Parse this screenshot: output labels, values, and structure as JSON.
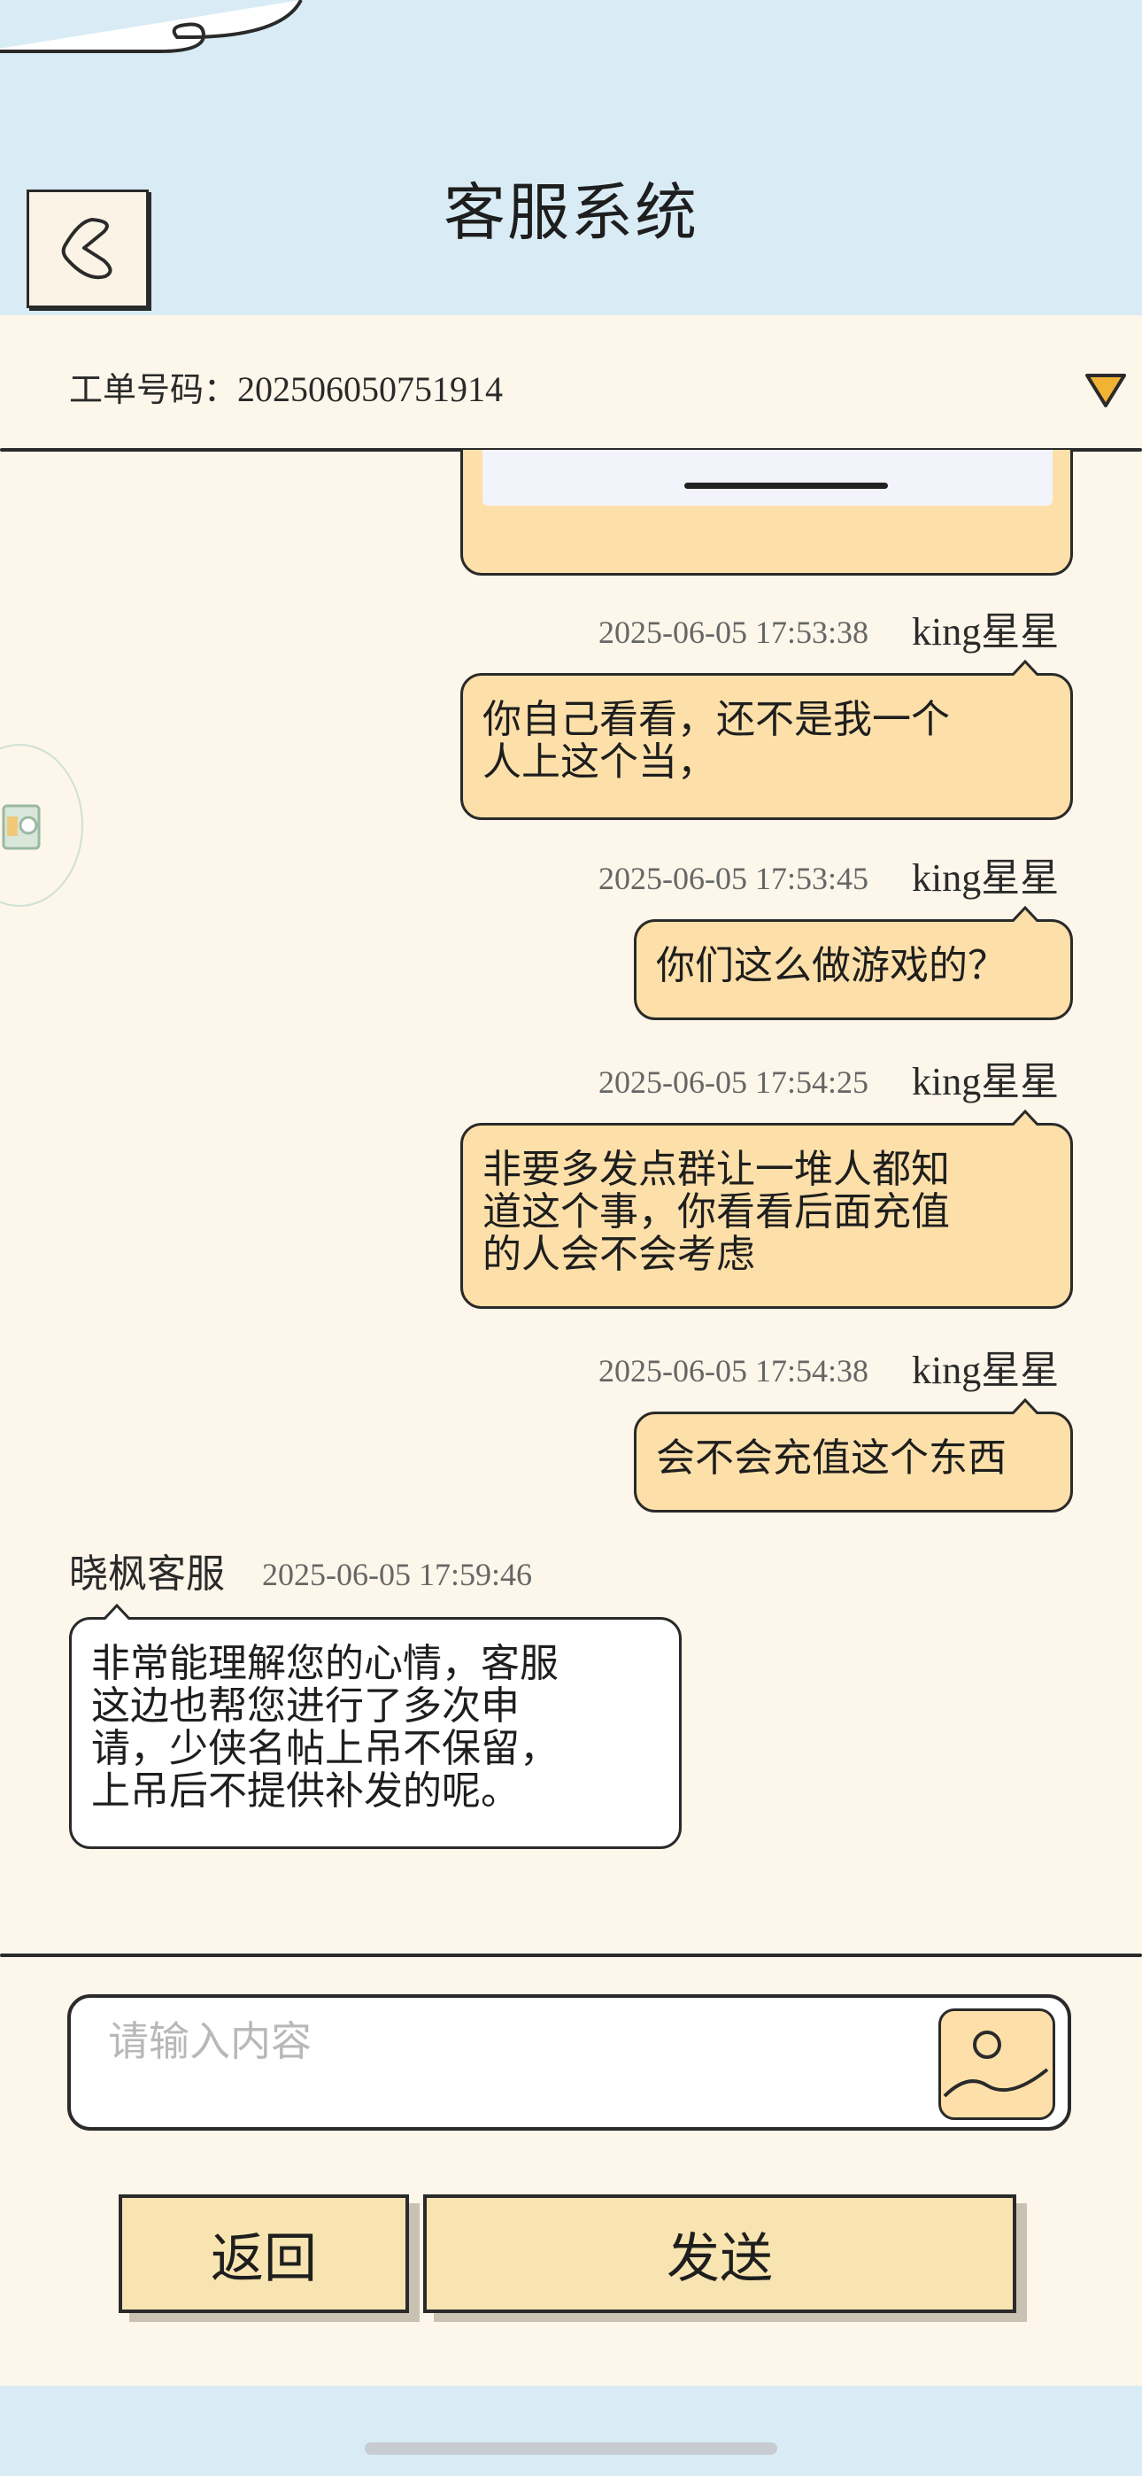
{
  "header": {
    "title": "客服系统"
  },
  "ticket": {
    "label": "工单号码：",
    "number": "202506050751914"
  },
  "messages": [
    {
      "time": "2025-06-05 17:53:38",
      "sender": "king星星",
      "text": "你自己看看，还不是我一个人上这个当，",
      "lines": [
        "你自己看看，还不是我一个",
        "人上这个当，"
      ]
    },
    {
      "time": "2025-06-05 17:53:45",
      "sender": "king星星",
      "text": "你们这么做游戏的？",
      "lines": [
        "你们这么做游戏的？"
      ]
    },
    {
      "time": "2025-06-05 17:54:25",
      "sender": "king星星",
      "text": "非要多发点群让一堆人都知道这个事，你看看后面充值的人会不会考虑",
      "lines": [
        "非要多发点群让一堆人都知",
        "道这个事，你看看后面充值",
        "的人会不会考虑"
      ]
    },
    {
      "time": "2025-06-05 17:54:38",
      "sender": "king星星",
      "text": "会不会充值这个东西",
      "lines": [
        "会不会充值这个东西"
      ]
    },
    {
      "time": "2025-06-05 17:59:46",
      "sender": "晓枫客服",
      "text": "非常能理解您的心情，客服这边也帮您进行了多次申请，少侠名帖上吊不保留，上吊后不提供补发的呢。",
      "lines": [
        "非常能理解您的心情，客服",
        "这边也帮您进行了多次申",
        "请，少侠名帖上吊不保留，",
        "上吊后不提供补发的呢。"
      ]
    }
  ],
  "input": {
    "placeholder": "请输入内容",
    "value": ""
  },
  "buttons": {
    "back": "返回",
    "send": "发送"
  },
  "colors": {
    "header_bg": "#d9ecf6",
    "page_bg": "#fdf6ea",
    "user_bubble": "#fde0a9",
    "agent_bubble": "#ffffff",
    "button_bg": "#f7e4b1",
    "outline": "#2a2a2a"
  },
  "icons": {
    "back": "back-chevron-icon",
    "dropdown": "dropdown-triangle-icon",
    "image": "image-upload-icon"
  }
}
